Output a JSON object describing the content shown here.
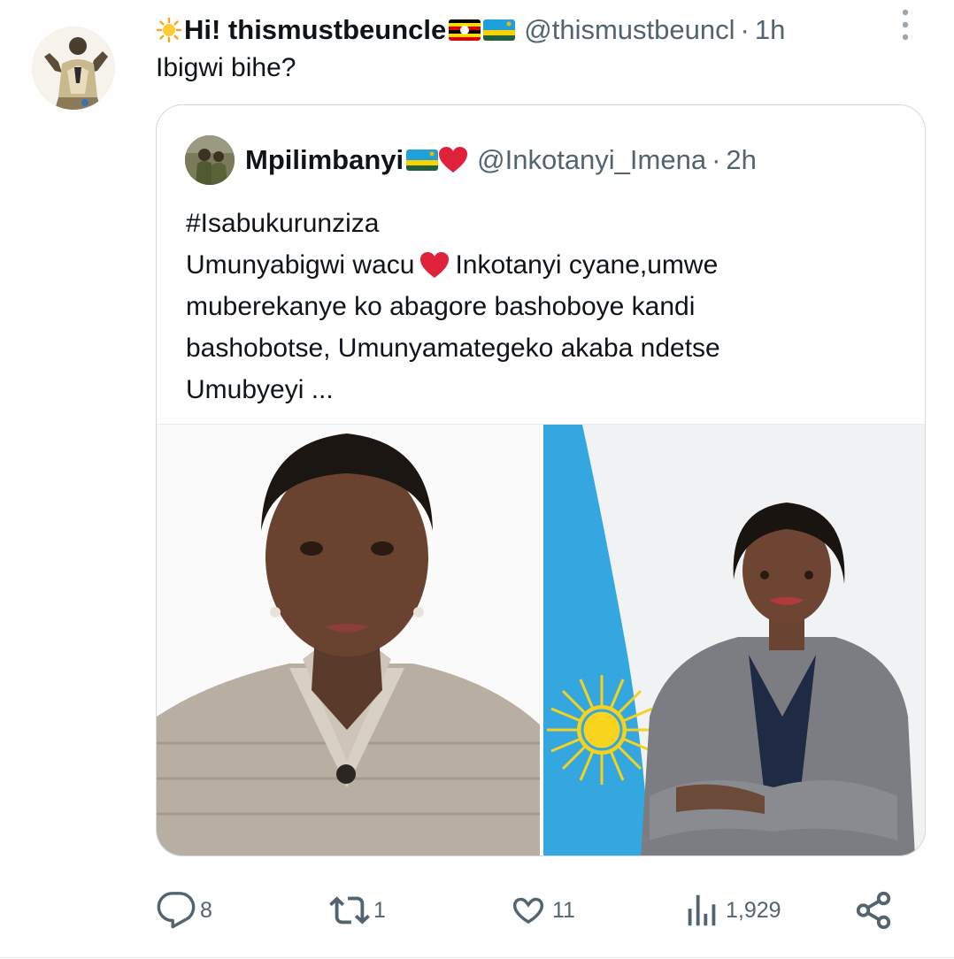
{
  "tweet": {
    "display_name": "Hi! thismustbeuncle",
    "handle": "@thismustbeuncl",
    "separator": "·",
    "time": "1h",
    "text": "Ibigwi bihe?"
  },
  "quoted": {
    "display_name": "Mpilimbanyi",
    "handle": "@Inkotanyi_Imena",
    "separator": "·",
    "time": "2h",
    "lines": {
      "l1": "#Isabukurunziza",
      "l2a": "Umunyabigwi wacu",
      "l2b": "Inkotanyi cyane,umwe",
      "l3": "muberekanye ko abagore bashoboye kandi",
      "l4": "bashobotse, Umunyamategeko akaba ndetse",
      "l5": "Umubyeyi ..."
    }
  },
  "actions": {
    "reply_count": "8",
    "retweet_count": "1",
    "like_count": "11",
    "views_count": "1,929"
  },
  "icons": {
    "more": "more-vertical-icon",
    "reply": "reply-icon",
    "retweet": "retweet-icon",
    "like": "heart-icon",
    "views": "views-icon",
    "share": "share-icon"
  },
  "colors": {
    "text": "#0f1419",
    "muted": "#536471",
    "border": "#cfd9de",
    "heart": "#e0213a"
  }
}
